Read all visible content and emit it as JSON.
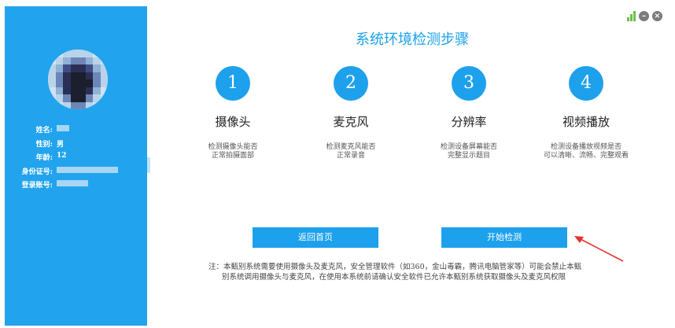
{
  "title": "系统环境检测步骤",
  "user": {
    "name_label": "姓名:",
    "gender_label": "性别:",
    "gender_value": "男",
    "age_label": "年龄:",
    "age_value": "12",
    "id_label": "身份证号:",
    "account_label": "登录账号:"
  },
  "steps": [
    {
      "number": "1",
      "name": "摄像头",
      "desc_line1": "检测摄像头能否",
      "desc_line2": "正常拍摄面部"
    },
    {
      "number": "2",
      "name": "麦克风",
      "desc_line1": "检测麦克风能否",
      "desc_line2": "正常录音"
    },
    {
      "number": "3",
      "name": "分辨率",
      "desc_line1": "检测设备屏幕能否",
      "desc_line2": "完整显示题目"
    },
    {
      "number": "4",
      "name": "视频播放",
      "desc_line1": "检测设备播放视频是否",
      "desc_line2": "可以清晰、流畅、完整观看"
    }
  ],
  "buttons": {
    "back_home": "返回首页",
    "start_check": "开始检测"
  },
  "note": {
    "line1": "注：本甄别系统需要使用摄像头及麦克风，安全管理软件（如360，金山毒霸，腾讯电脑管家等）可能会禁止本甄",
    "line2": "别系统调用摄像头与麦克风，在使用本系统前请确认安全软件已允许本甄别系统获取摄像头及麦克风权限"
  },
  "colors": {
    "sidebar": "#22a3ee",
    "accent": "#1ea1ec",
    "signal": "#6cc04a",
    "arrow": "#e3332d"
  },
  "icons": {
    "signal": "signal-bars-icon",
    "minimize": "minimize-icon",
    "close": "close-icon"
  }
}
